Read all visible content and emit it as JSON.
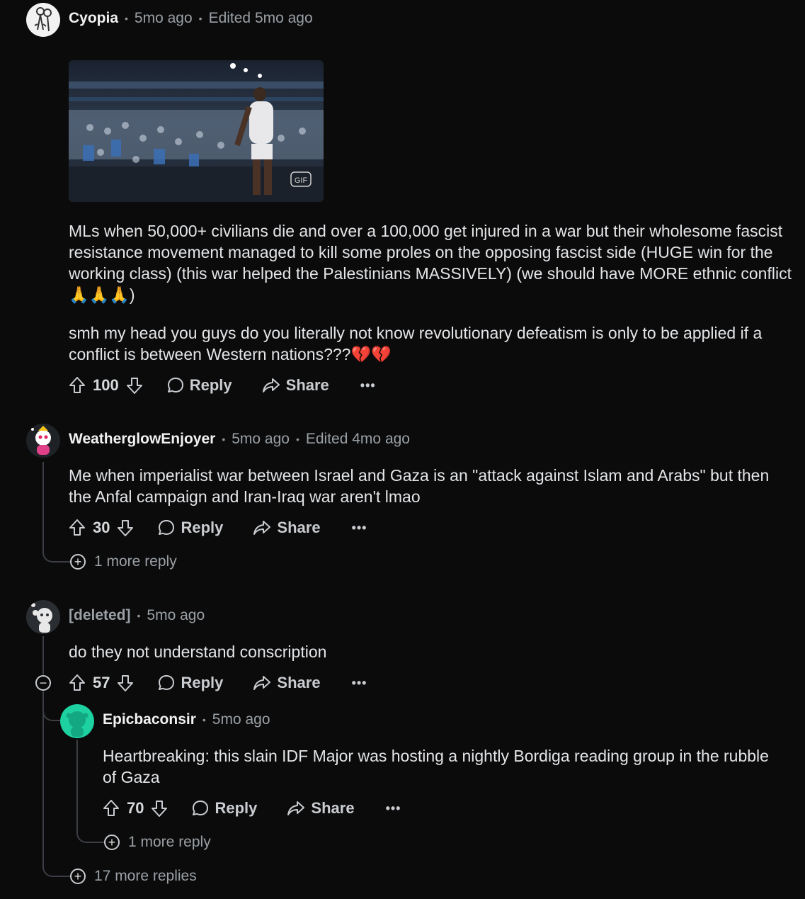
{
  "comments": [
    {
      "username": "Cyopia",
      "time": "5mo ago",
      "edited": "Edited 5mo ago",
      "gif_badge": "GIF",
      "paragraphs": [
        "MLs when 50,000+ civilians die and over a 100,000 get injured in a war but their wholesome fascist resistance movement managed to kill some proles on the opposing fascist side (HUGE win for the working class) (this war helped the Palestinians MASSIVELY) (we should have MORE ethnic conflict🙏🙏🙏)",
        "smh my head you guys do you literally not know revolutionary defeatism is only to be applied if a conflict is between Western nations???💔💔"
      ],
      "score": "100",
      "reply_label": "Reply",
      "share_label": "Share",
      "more_label": "•••"
    },
    {
      "username": "WeatherglowEnjoyer",
      "time": "5mo ago",
      "edited": "Edited 4mo ago",
      "text": "Me when imperialist war between Israel and Gaza is an \"attack against Islam and Arabs\" but then the Anfal campaign and Iran-Iraq war aren't lmao",
      "score": "30",
      "reply_label": "Reply",
      "share_label": "Share",
      "more_label": "•••",
      "more_replies": "1 more reply"
    },
    {
      "username": "[deleted]",
      "time": "5mo ago",
      "text": "do they not understand conscription",
      "score": "57",
      "reply_label": "Reply",
      "share_label": "Share",
      "more_label": "•••",
      "more_replies": "17 more replies"
    },
    {
      "username": "Epicbaconsir",
      "time": "5mo ago",
      "text": "Heartbreaking: this slain IDF Major was hosting a nightly Bordiga reading group in the rubble of Gaza",
      "score": "70",
      "reply_label": "Reply",
      "share_label": "Share",
      "more_label": "•••",
      "more_replies": "1 more reply"
    }
  ],
  "icons": {
    "upvote": "arrow-up-outline",
    "downvote": "arrow-down-outline",
    "reply": "speech-bubble",
    "share": "forward-arrow",
    "expand": "plus-circle",
    "collapse": "minus-circle"
  },
  "colors": {
    "background": "#0b0b0b",
    "text": "#e3e5e8",
    "muted": "#9aa0a6",
    "thread_line": "#3b3f44",
    "avatar_teal": "#1dd1a1"
  }
}
